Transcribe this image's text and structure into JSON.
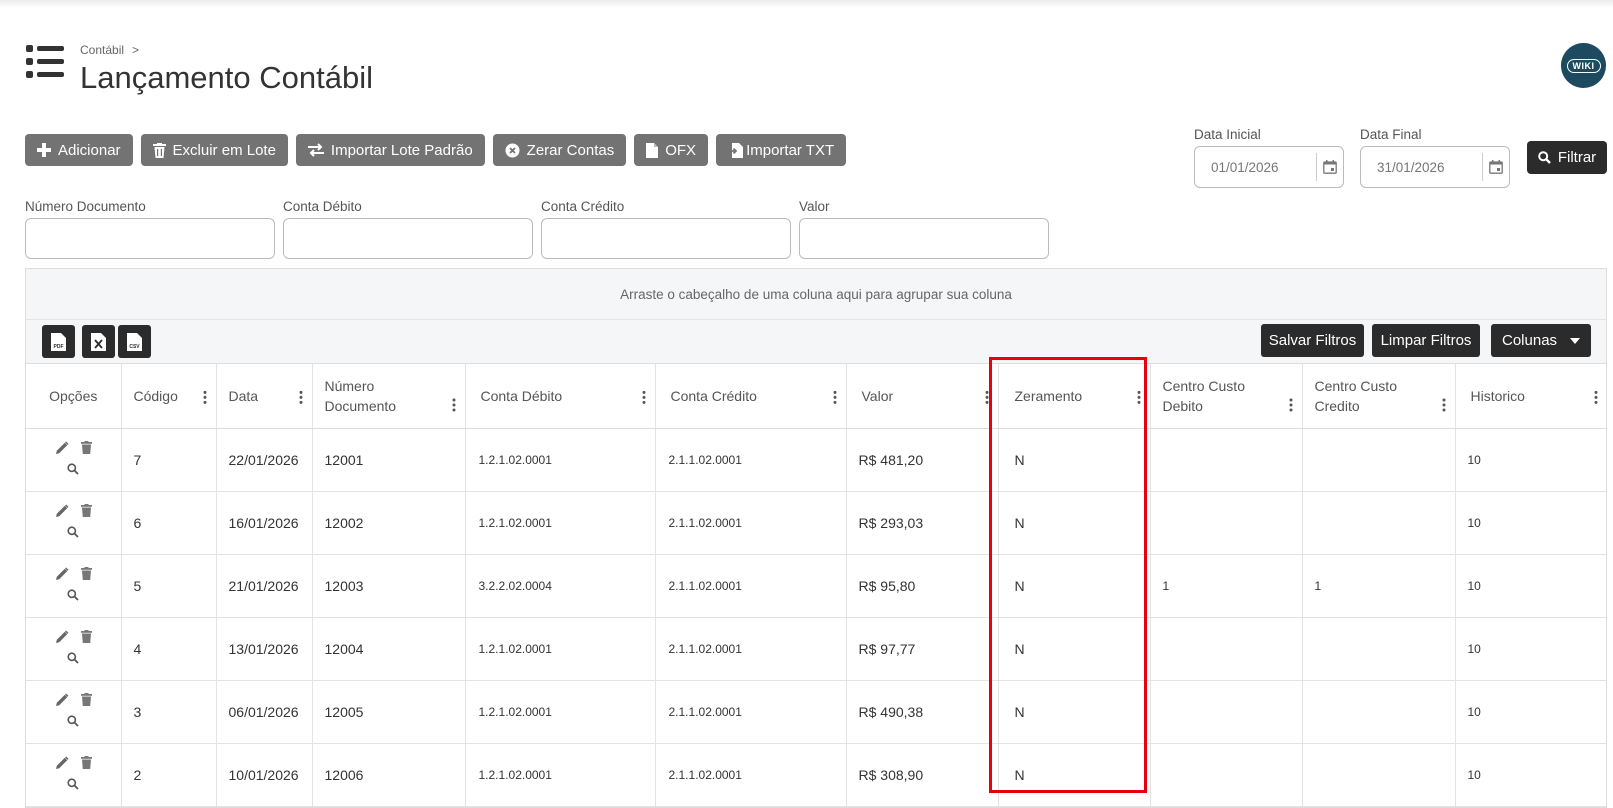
{
  "header": {
    "breadcrumb": "Contábil",
    "breadcrumb_sep": ">",
    "title": "Lançamento Contábil",
    "wiki_label": "WIKI"
  },
  "toolbar": {
    "add": "Adicionar",
    "delete_batch": "Excluir em Lote",
    "import_batch": "Importar Lote Padrão",
    "zero_accounts": "Zerar Contas",
    "ofx": "OFX",
    "import_txt": "Importar TXT"
  },
  "filters": {
    "start_date_label": "Data Inicial",
    "start_date": "01/01/2026",
    "end_date_label": "Data Final",
    "end_date": "31/01/2026",
    "filter_button": "Filtrar",
    "doc_number_label": "Número Documento",
    "debit_label": "Conta Débito",
    "credit_label": "Conta Crédito",
    "value_label": "Valor"
  },
  "grid": {
    "group_panel_text": "Arraste o cabeçalho de uma coluna aqui para agrupar sua coluna",
    "save_filters": "Salvar Filtros",
    "clear_filters": "Limpar Filtros",
    "columns_button": "Colunas",
    "columns": [
      "Opções",
      "Código",
      "Data",
      "Número Documento",
      "Conta Débito",
      "Conta Crédito",
      "Valor",
      "Zeramento",
      "Centro Custo Debito",
      "Centro Custo Credito",
      "Historico"
    ],
    "rows": [
      {
        "codigo": "7",
        "data": "22/01/2026",
        "numero": "12001",
        "debito": "1.2.1.02.0001",
        "credito": "2.1.1.02.0001",
        "valor": "R$ 481,20",
        "zeramento": "N",
        "cc_debito": "",
        "cc_credito": "",
        "historico": "10"
      },
      {
        "codigo": "6",
        "data": "16/01/2026",
        "numero": "12002",
        "debito": "1.2.1.02.0001",
        "credito": "2.1.1.02.0001",
        "valor": "R$ 293,03",
        "zeramento": "N",
        "cc_debito": "",
        "cc_credito": "",
        "historico": "10"
      },
      {
        "codigo": "5",
        "data": "21/01/2026",
        "numero": "12003",
        "debito": "3.2.2.02.0004",
        "credito": "2.1.1.02.0001",
        "valor": "R$ 95,80",
        "zeramento": "N",
        "cc_debito": "1",
        "cc_credito": "1",
        "historico": "10"
      },
      {
        "codigo": "4",
        "data": "13/01/2026",
        "numero": "12004",
        "debito": "1.2.1.02.0001",
        "credito": "2.1.1.02.0001",
        "valor": "R$ 97,77",
        "zeramento": "N",
        "cc_debito": "",
        "cc_credito": "",
        "historico": "10"
      },
      {
        "codigo": "3",
        "data": "06/01/2026",
        "numero": "12005",
        "debito": "1.2.1.02.0001",
        "credito": "2.1.1.02.0001",
        "valor": "R$ 490,38",
        "zeramento": "N",
        "cc_debito": "",
        "cc_credito": "",
        "historico": "10"
      },
      {
        "codigo": "2",
        "data": "10/01/2026",
        "numero": "12006",
        "debito": "1.2.1.02.0001",
        "credito": "2.1.1.02.0001",
        "valor": "R$ 308,90",
        "zeramento": "N",
        "cc_debito": "",
        "cc_credito": "",
        "historico": "10"
      }
    ]
  },
  "colors": {
    "button_gray": "#737373",
    "button_dark": "#2b2b2b",
    "highlight_red": "#e8000d",
    "wiki_blue": "#1d4a5e"
  },
  "icons": [
    "list-menu-icon",
    "plus-icon",
    "trash-icon",
    "swap-icon",
    "x-circle-icon",
    "file-icon",
    "file-import-icon",
    "calendar-icon",
    "search-icon",
    "pdf-icon",
    "excel-icon",
    "csv-icon",
    "caret-down-icon",
    "pencil-icon",
    "kebab-icon"
  ]
}
